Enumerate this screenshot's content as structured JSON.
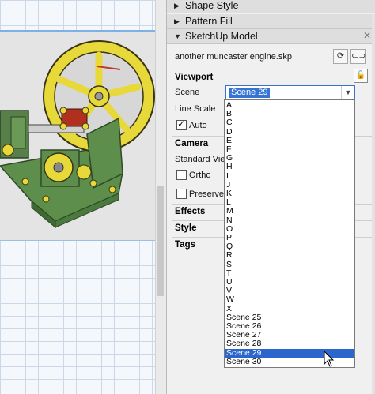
{
  "trays": {
    "shape_style": "Shape Style",
    "pattern_fill": "Pattern Fill",
    "sketchup_model": "SketchUp Model"
  },
  "model": {
    "file_name": "another muncaster engine.skp"
  },
  "viewport": {
    "heading": "Viewport",
    "scene_label": "Scene",
    "scene_value": "Scene 29",
    "line_scale_label": "Line Scale",
    "auto_label": "Auto",
    "auto_checked": true
  },
  "camera": {
    "heading": "Camera",
    "standard_views_label": "Standard Views",
    "ortho_label": "Ortho",
    "preserve_label": "Preserve Sc"
  },
  "sections": {
    "effects": "Effects",
    "style": "Style",
    "tags": "Tags"
  },
  "scene_options": [
    "A",
    "B",
    "C",
    "D",
    "E",
    "F",
    "G",
    "H",
    "I",
    "J",
    "K",
    "L",
    "M",
    "N",
    "O",
    "P",
    "Q",
    "R",
    "S",
    "T",
    "U",
    "V",
    "W",
    "X",
    "Scene 25",
    "Scene 26",
    "Scene 27",
    "Scene 28",
    "Scene 29",
    "Scene 30"
  ],
  "selected_scene_index": 28,
  "colors": {
    "selection": "#2b66cc",
    "flywheel": "#e8d93a",
    "engine_base": "#5a8a4a",
    "grid": "#ccd8e8"
  }
}
